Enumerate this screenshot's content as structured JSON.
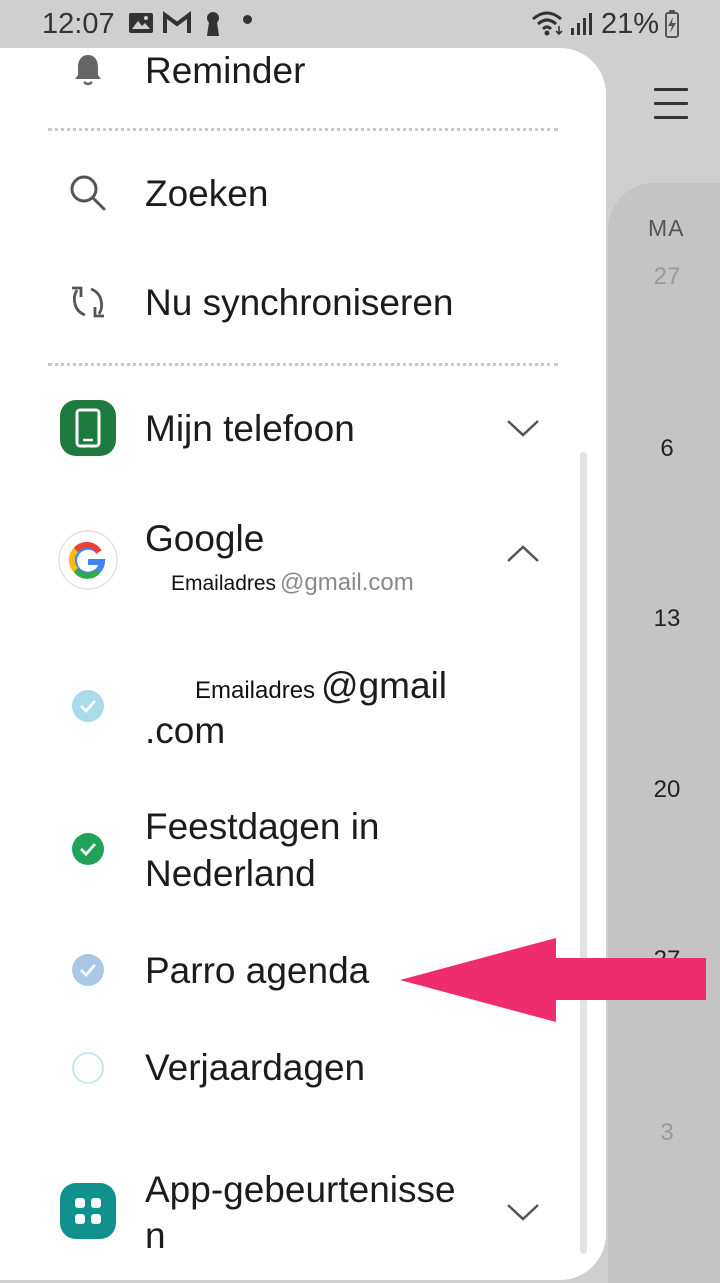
{
  "status_bar": {
    "time": "12:07",
    "battery": "21%"
  },
  "drawer": {
    "reminder_label": "Reminder",
    "search_label": "Zoeken",
    "sync_label": "Nu synchroniseren",
    "my_phone_label": "Mijn telefoon",
    "google": {
      "label": "Google",
      "account_mask": "Emailadres",
      "account_domain": "@gmail.com"
    },
    "calendars": {
      "account_cal_mask": "Emailadres",
      "account_cal_line1": "@gmail",
      "account_cal_line2": ".com",
      "holidays_line1": "Feestdagen in",
      "holidays_line2": "Nederland",
      "parro": "Parro agenda",
      "birthdays": "Verjaardagen"
    },
    "app_events_line1": "App-gebeurtenisse",
    "app_events_line2": "n"
  },
  "calendar_view": {
    "weekday": "MA",
    "dates": [
      "27",
      "6",
      "13",
      "20",
      "27",
      "3"
    ]
  },
  "colors": {
    "phone_green": "#1e7a3e",
    "check_green": "#21a35b",
    "check_light": "#a8dcea",
    "check_blue": "#a9c8e6",
    "app_teal": "#11918e",
    "arrow": "#ef2c6d"
  }
}
